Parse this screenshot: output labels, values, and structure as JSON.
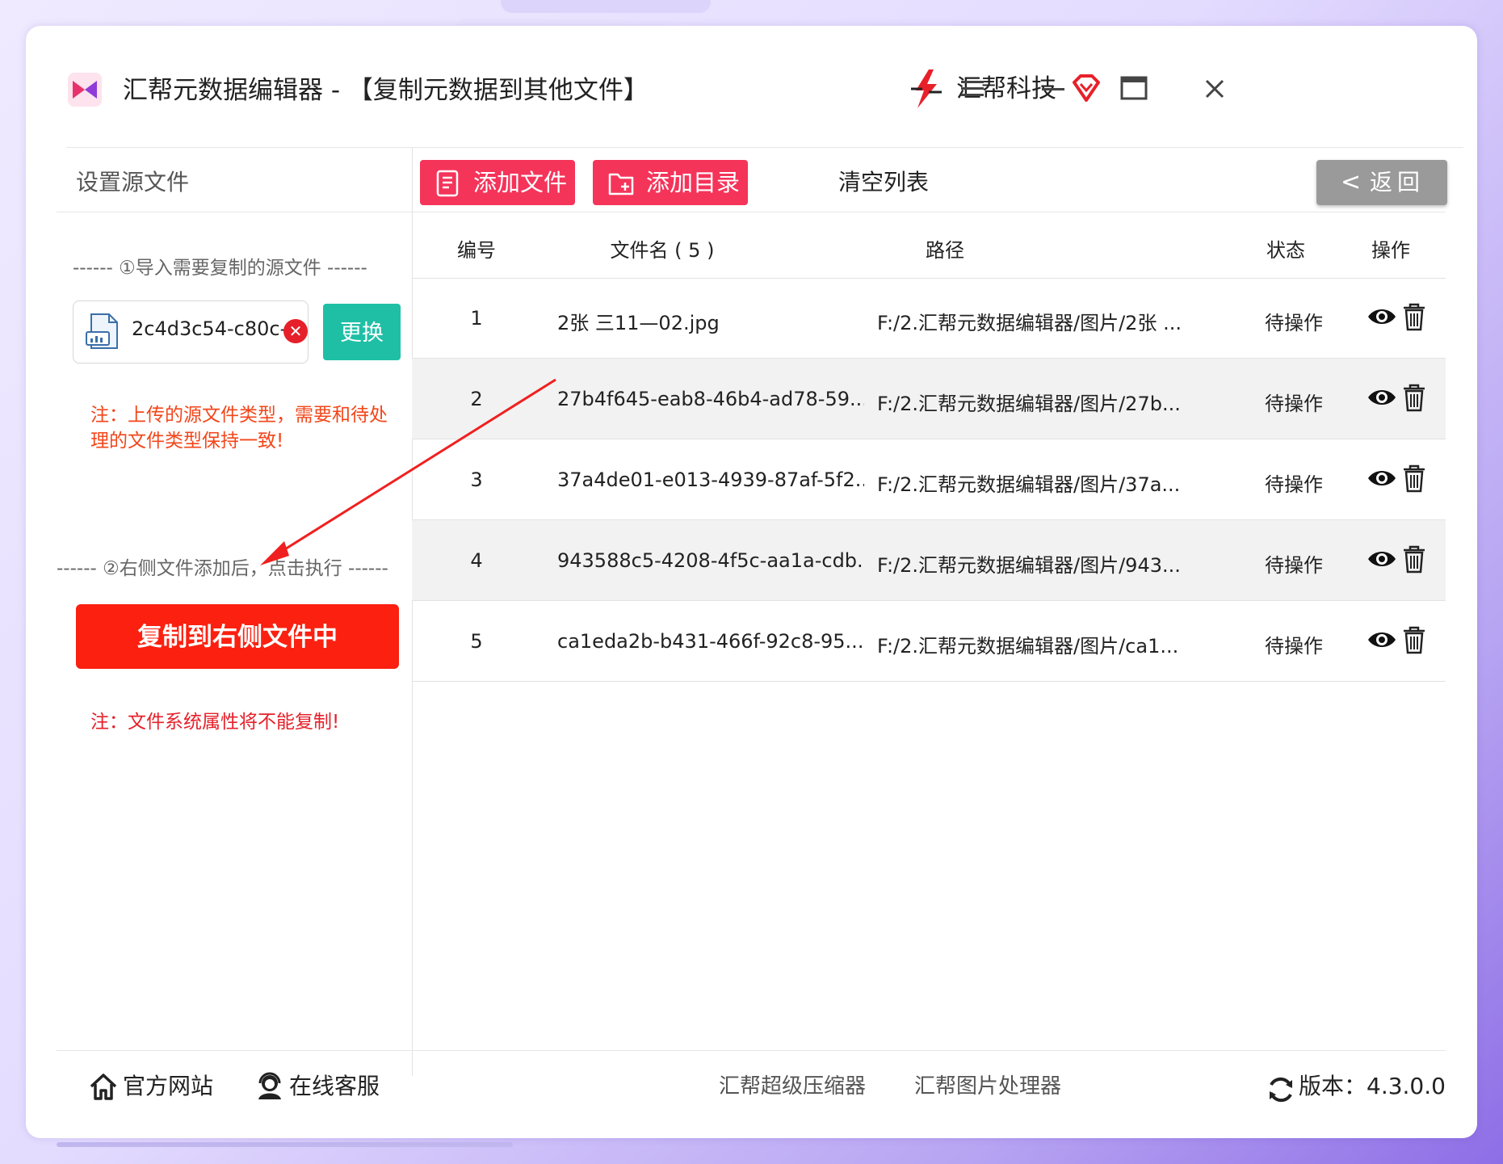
{
  "window": {
    "title": "汇帮元数据编辑器 - 【复制元数据到其他文件】",
    "brand": "汇帮科技"
  },
  "left": {
    "header": "设置源文件",
    "step1": "------ ①导入需要复制的源文件 ------",
    "source_file": "2c4d3c54-c80c-4…",
    "replace_label": "更换",
    "note1": "注：上传的源文件类型，需要和待处理的文件类型保持一致!",
    "step2": "------ ②右侧文件添加后，点击执行 ------",
    "execute_label": "复制到右侧文件中",
    "note2": "注：文件系统属性将不能复制!"
  },
  "toolbar": {
    "add_file": "添加文件",
    "add_dir": "添加目录",
    "clear_list": "清空列表",
    "back": "返回",
    "back_chevron": "<"
  },
  "table": {
    "headers": {
      "no": "编号",
      "name": "文件名 ( 5 )",
      "path": "路径",
      "status": "状态",
      "ops": "操作"
    },
    "rows": [
      {
        "no": "1",
        "name": "2张 三11—02.jpg",
        "path": "F:/2.汇帮元数据编辑器/图片/2张 ...",
        "status": "待操作"
      },
      {
        "no": "2",
        "name": "27b4f645-eab8-46b4-ad78-59...",
        "path": "F:/2.汇帮元数据编辑器/图片/27b...",
        "status": "待操作"
      },
      {
        "no": "3",
        "name": "37a4de01-e013-4939-87af-5f2...",
        "path": "F:/2.汇帮元数据编辑器/图片/37a...",
        "status": "待操作"
      },
      {
        "no": "4",
        "name": "943588c5-4208-4f5c-aa1a-cdb...",
        "path": "F:/2.汇帮元数据编辑器/图片/943...",
        "status": "待操作"
      },
      {
        "no": "5",
        "name": "ca1eda2b-b431-466f-92c8-95...",
        "path": "F:/2.汇帮元数据编辑器/图片/ca1...",
        "status": "待操作"
      }
    ]
  },
  "footer": {
    "website": "官方网站",
    "service": "在线客服",
    "compressor": "汇帮超级压缩器",
    "image_tool": "汇帮图片处理器",
    "version": "版本：4.3.0.0"
  },
  "colors": {
    "accent_pink": "#f5345a",
    "teal": "#1fbfa6",
    "execute_red": "#fb2010",
    "note_red": "#f2461a",
    "back_gray": "#9a9a9a"
  }
}
